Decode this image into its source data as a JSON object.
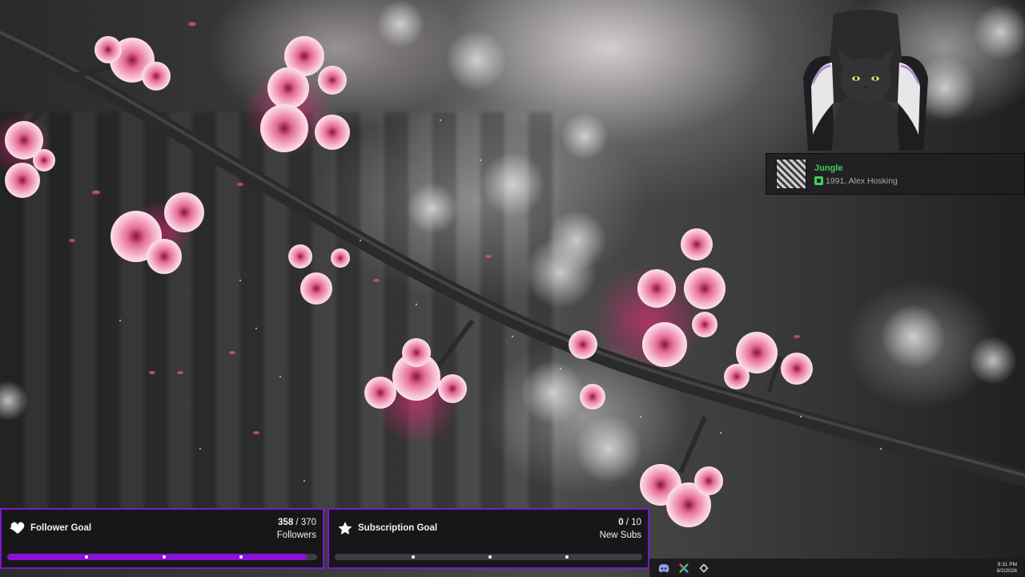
{
  "now_playing": {
    "title": "Jungle",
    "meta": "1991, Alex Hosking"
  },
  "goals": {
    "follower": {
      "title": "Follower Goal",
      "current": "358",
      "separator": " / ",
      "target": "370",
      "unit": "Followers",
      "progress": 0.9676
    },
    "subscription": {
      "title": "Subscription Goal",
      "current": "0",
      "separator": " / ",
      "target": "10",
      "unit": "New Subs",
      "progress": 0
    }
  },
  "taskbar": {
    "icons": [
      "discord-icon",
      "xbox-app-icon",
      "steelseries-icon"
    ],
    "time": "8:31 PM",
    "date": "8/2/2026"
  },
  "colors": {
    "accent": "#7b18c9",
    "bar_fill": "#8c10d6",
    "music_green": "#3ecf57",
    "blossom_pink": "#f2a5c4"
  }
}
